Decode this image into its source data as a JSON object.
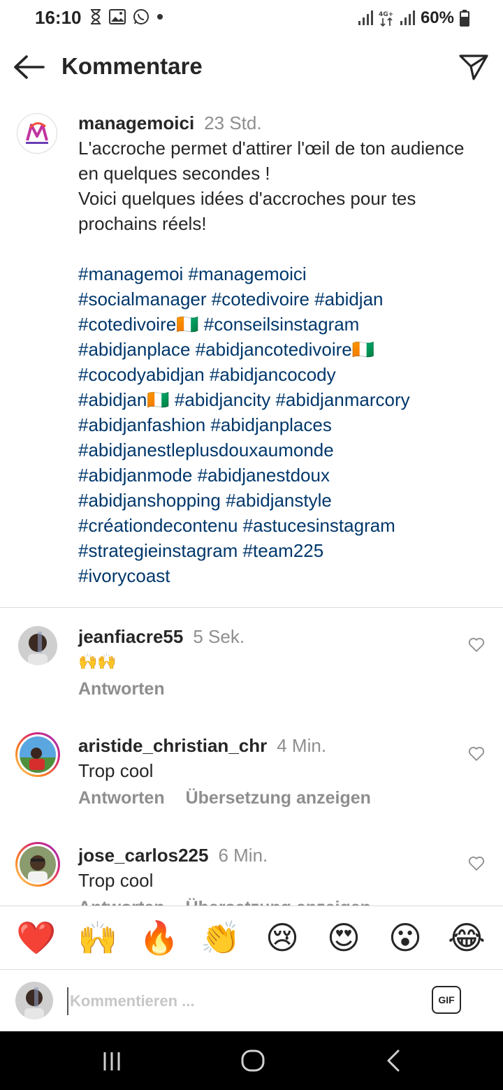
{
  "status": {
    "time": "16:10",
    "battery": "60%",
    "network": "4G+"
  },
  "header": {
    "title": "Kommentare"
  },
  "caption": {
    "username": "managemoici",
    "time": "23 Std.",
    "text": "L'accroche permet d'attirer l'œil de ton audience en quelques secondes !\nVoici quelques idées d'accroches pour tes prochains réels!",
    "hashtag_lines": [
      "#managemoi #managemoici",
      "#socialmanager #cotedivoire #abidjan",
      "#cotedivoire🇨🇮 #conseilsinstagram",
      "#abidjanplace #abidjancotedivoire🇨🇮",
      "#cocodyabidjan #abidjancocody",
      "#abidjan🇨🇮 #abidjancity #abidjanmarcory",
      "#abidjanfashion #abidjanplaces",
      "#abidjanestleplusdouxaumonde",
      "#abidjanmode #abidjanestdoux",
      "#abidjanshopping #abidjanstyle",
      "#créationdecontenu #astucesinstagram",
      "#strategieinstagram #team225",
      "#ivorycoast"
    ]
  },
  "comments": [
    {
      "username": "jeanfiacre55",
      "time": "5 Sek.",
      "text": "🙌🙌",
      "reply": "Antworten",
      "translate": ""
    },
    {
      "username": "aristide_christian_chr",
      "time": "4 Min.",
      "text": "Trop cool",
      "reply": "Antworten",
      "translate": "Übersetzung anzeigen"
    },
    {
      "username": "jose_carlos225",
      "time": "6 Min.",
      "text": "Trop cool",
      "reply": "Antworten",
      "translate": "Übersetzung anzeigen"
    }
  ],
  "emoji_bar": [
    "❤️",
    "🙌",
    "🔥",
    "👏",
    "😢",
    "😍",
    "😮",
    "😂"
  ],
  "composer": {
    "placeholder": "Kommentieren ...",
    "gif_label": "GIF"
  },
  "icons": {
    "back": "arrow-left-icon",
    "send": "paper-plane-icon",
    "like": "heart-outline-icon"
  }
}
